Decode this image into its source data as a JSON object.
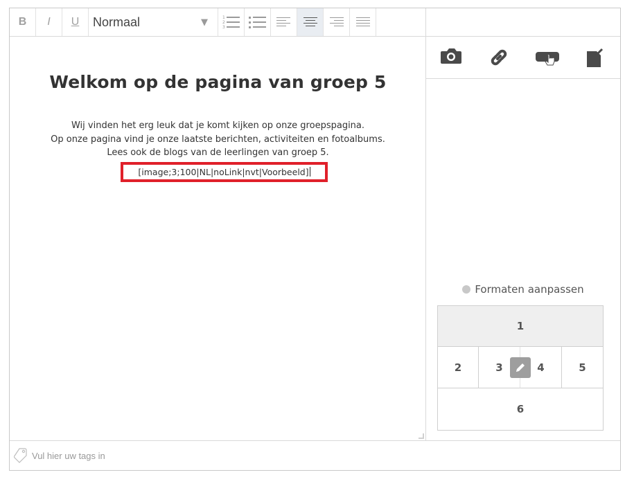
{
  "toolbar": {
    "bold_label": "B",
    "italic_label": "I",
    "underline_label": "U",
    "format_value": "Normaal",
    "tools": [
      "numbered-list-icon",
      "bullet-list-icon",
      "align-left-icon",
      "align-center-icon",
      "align-right-icon",
      "align-justify-icon"
    ],
    "active_tool": "align-center-icon"
  },
  "editor": {
    "title": "Welkom op de pagina van groep 5",
    "lines": [
      "Wij vinden het erg leuk dat je komt kijken op onze groepspagina.",
      "Op onze pagina vind je onze laatste berichten, activiteiten en fotoalbums.",
      "Lees ook de blogs van de leerlingen van groep 5."
    ],
    "placeholder": "[image;3;100|NL|noLink|nvt|Voorbeeld]",
    "highlight_color": "#e0202a"
  },
  "panel": {
    "icons": [
      "camera-icon",
      "link-icon",
      "button-insert-icon",
      "export-icon"
    ],
    "formaten_label": "Formaten aanpassen",
    "grid": {
      "cells": [
        "1",
        "2",
        "3",
        "4",
        "5",
        "6"
      ]
    }
  },
  "tags": {
    "placeholder": "Vul hier uw tags in"
  }
}
